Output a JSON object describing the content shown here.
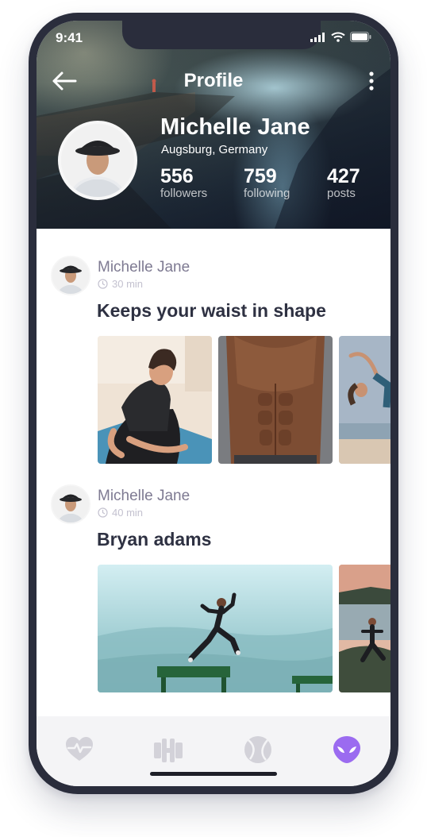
{
  "status_bar": {
    "time": "9:41"
  },
  "header": {
    "title": "Profile",
    "profile": {
      "name": "Michelle Jane",
      "location": "Augsburg, Germany",
      "stats": [
        {
          "value": "556",
          "label": "followers"
        },
        {
          "value": "759",
          "label": "following"
        },
        {
          "value": "427",
          "label": "posts"
        }
      ]
    }
  },
  "posts": [
    {
      "author": "Michelle Jane",
      "time": "30 min",
      "title": "Keeps your waist in shape",
      "images": [
        "woman-on-yoga-mat-photo",
        "abs-torso-photo",
        "woman-stretching-beach-photo"
      ]
    },
    {
      "author": "Michelle Jane",
      "time": "40 min",
      "title": "Bryan adams",
      "images": [
        "man-jumping-benches-photo",
        "woman-yoga-seaside-photo"
      ]
    }
  ],
  "bottom_nav": {
    "items": [
      {
        "icon": "heart-pulse-icon",
        "active": false
      },
      {
        "icon": "dumbbell-icon",
        "active": false
      },
      {
        "icon": "tennis-ball-icon",
        "active": false
      },
      {
        "icon": "alien-icon",
        "active": true
      }
    ],
    "active_color": "#9b6bf0",
    "inactive_color": "#d3d2d9"
  }
}
